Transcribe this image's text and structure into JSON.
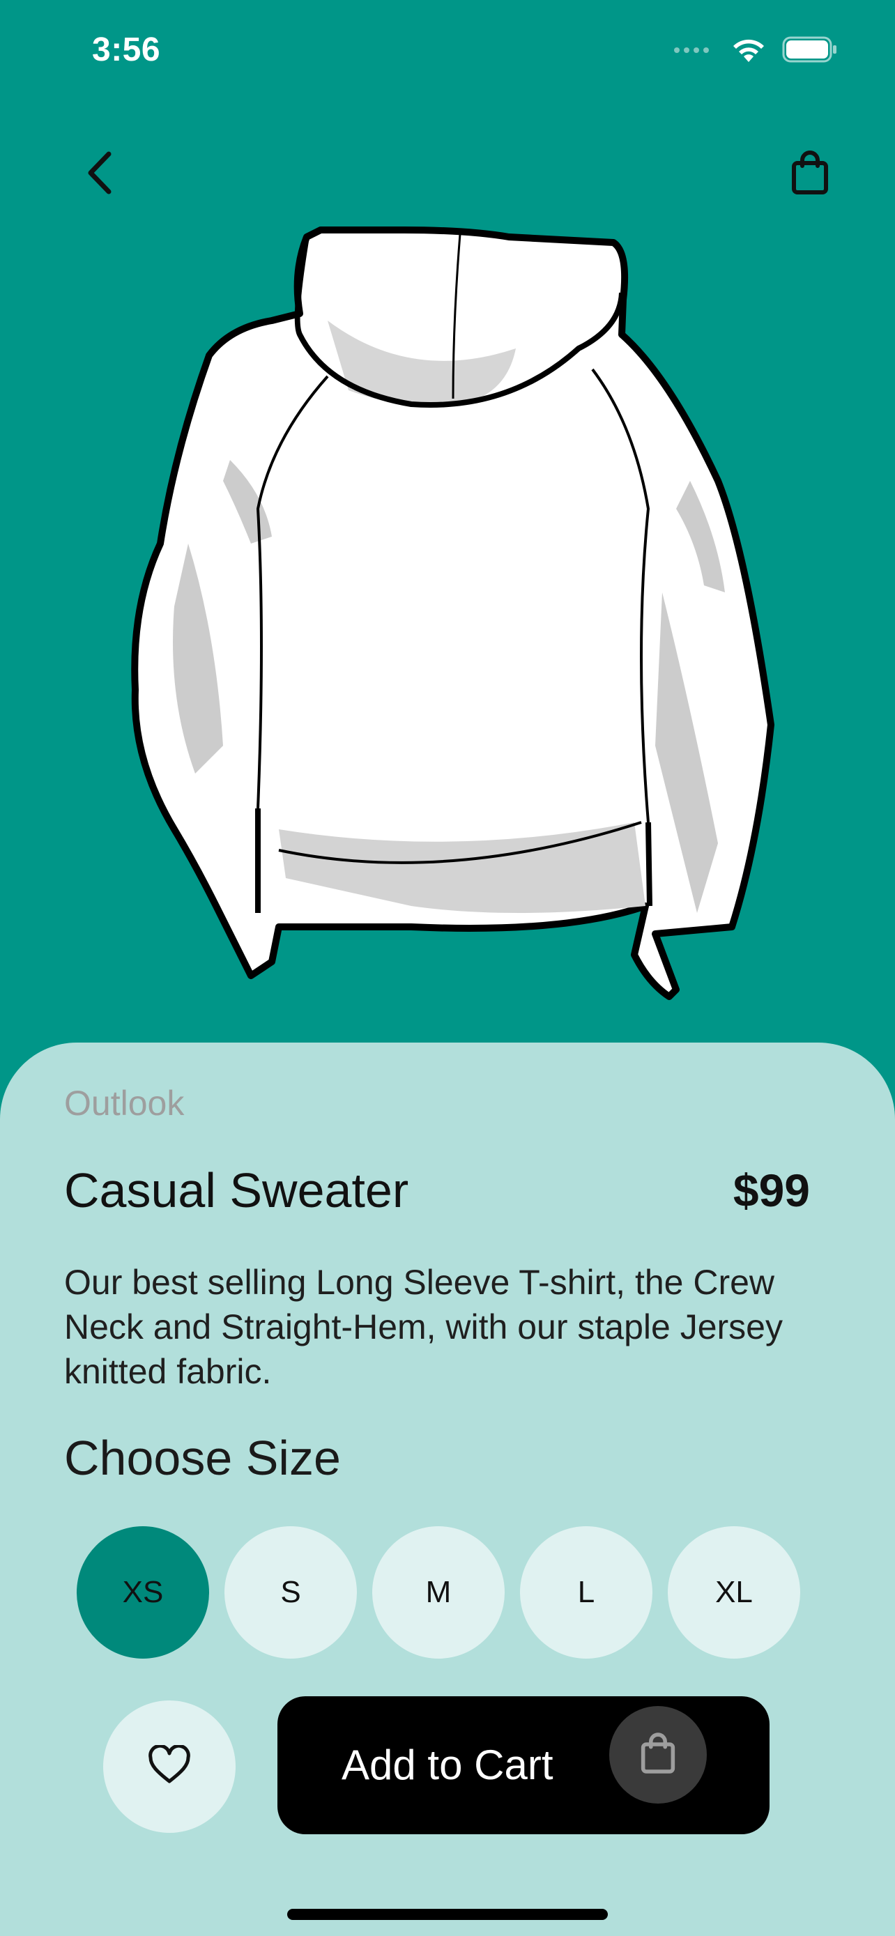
{
  "status_bar": {
    "time": "3:56",
    "icons": [
      "signal-icon",
      "wifi-icon",
      "battery-icon"
    ]
  },
  "nav": {
    "back_icon": "chevron-left-icon",
    "bag_icon": "shopping-bag-icon"
  },
  "product": {
    "image_icon": "hoodie-illustration",
    "brand": "Outlook",
    "name": "Casual Sweater",
    "price": "$99",
    "description": "Our best selling Long Sleeve T-shirt, the Crew Neck and Straight-Hem, with our staple Jersey knitted fabric."
  },
  "size_section": {
    "heading": "Choose Size",
    "options": [
      "XS",
      "S",
      "M",
      "L",
      "XL"
    ],
    "selected": "XS"
  },
  "actions": {
    "favorite_icon": "heart-icon",
    "add_to_cart_label": "Add to Cart",
    "cart_icon": "shopping-bag-icon"
  },
  "colors": {
    "background": "#009688",
    "sheet": "#b2dfdb",
    "chip": "#e0f2f1",
    "chip_selected": "#00897b",
    "cta": "#000000"
  }
}
